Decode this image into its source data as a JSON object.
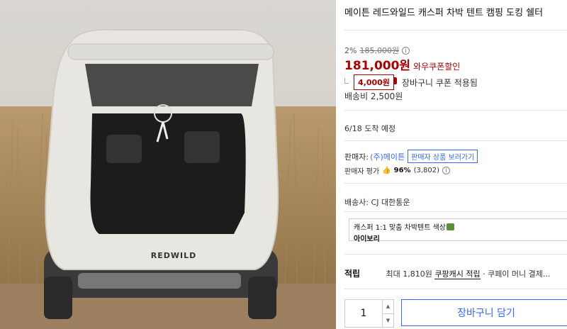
{
  "product": {
    "title": "메이튼 레드와일드 캐스퍼 차박 텐트 캠핑 도킹 쉘터",
    "image_alt": "REDWILD",
    "image_brand_text": "REDWILD"
  },
  "price": {
    "discount_rate": "2%",
    "original_price": "185,000원",
    "sale_price": "181,000원",
    "coupon_label": "와우쿠폰할인",
    "cart_coupon_amount": "4,000원",
    "cart_coupon_text": "장바구니 쿠폰 적용됨"
  },
  "shipping": {
    "fee": "배송비 2,500원",
    "arrival": "6/18 도착 예정"
  },
  "seller": {
    "label": "판매자:",
    "name": "(주)메이튼",
    "products_button": "판매자 상품 보러가기",
    "rating_label": "판매자 평가",
    "rating_pct": "96%",
    "rating_count": "(3,802)"
  },
  "carrier": {
    "text": "배송사:  CJ 대한통운"
  },
  "option": {
    "name": "캐스퍼 1:1 맞춤 차박텐트 색상",
    "selected": "아이보리"
  },
  "points": {
    "label": "적립",
    "max_text": "최대 1,810원",
    "cash_link": "쿠팡캐시 적립",
    "rest": "· 쿠페이 머니 결제..."
  },
  "purchase": {
    "quantity": "1",
    "cart_button": "장바구니 담기"
  },
  "colors": {
    "accent_red": "#ae0000",
    "link_blue": "#346aff"
  }
}
